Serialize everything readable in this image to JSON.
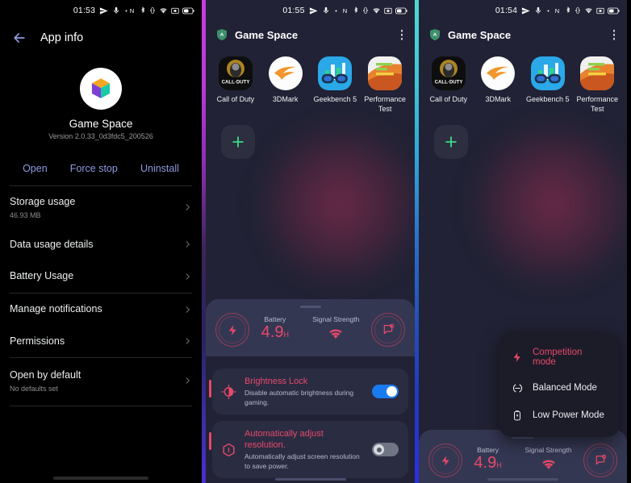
{
  "panel1": {
    "statusbar": {
      "time": "01:53",
      "icons_left": [
        "send-icon",
        "silent-icon",
        "dot-icon"
      ],
      "icons_right": [
        "nfc-icon",
        "bluetooth-icon",
        "vibrate-icon",
        "wifi-icon",
        "sim-icon",
        "battery-icon"
      ]
    },
    "appbar": {
      "back": "back-arrow",
      "title": "App info"
    },
    "hero": {
      "icon": "game-space-cube-icon",
      "app_name": "Game Space",
      "version": "Version 2.0.33_0d3fdc5_200526"
    },
    "actions": [
      {
        "label": "Open",
        "name": "open-button"
      },
      {
        "label": "Force stop",
        "name": "force-stop-button"
      },
      {
        "label": "Uninstall",
        "name": "uninstall-button"
      }
    ],
    "rows_group_1": [
      {
        "title": "Storage usage",
        "sub": "46.93 MB",
        "name": "row-storage-usage"
      },
      {
        "title": "Data usage details",
        "sub": "",
        "name": "row-data-usage-details"
      },
      {
        "title": "Battery Usage",
        "sub": "",
        "name": "row-battery-usage"
      }
    ],
    "rows_group_2": [
      {
        "title": "Manage notifications",
        "sub": "",
        "name": "row-manage-notifications"
      },
      {
        "title": "Permissions",
        "sub": "",
        "name": "row-permissions"
      }
    ],
    "rows_group_3": [
      {
        "title": "Open by default",
        "sub": "No defaults set",
        "name": "row-open-by-default"
      }
    ]
  },
  "panel2": {
    "statusbar": {
      "time": "01:55"
    },
    "appbar": {
      "title": "Game Space",
      "logo": "game-space-shield-icon",
      "menu": "overflow-menu-icon"
    },
    "games": [
      {
        "label": "Call of Duty",
        "icon": "call-of-duty-icon"
      },
      {
        "label": "3DMark",
        "icon": "3dmark-icon"
      },
      {
        "label": "Geekbench 5",
        "icon": "geekbench-icon"
      },
      {
        "label": "Performance Test",
        "icon": "performancetest-icon"
      }
    ],
    "add_button": "add-game-button",
    "stats": {
      "left_icon": "performance-mode-icon",
      "right_icon": "notification-block-icon",
      "battery_caption": "Battery",
      "battery_value": "4.9",
      "battery_unit": "H",
      "signal_caption": "Signal Strength",
      "signal_icon": "wifi-signal-icon"
    },
    "toggles": [
      {
        "title": "Brightness Lock",
        "desc": "Disable automatic brightness during gaming.",
        "state": "on",
        "icon": "brightness-icon",
        "name": "toggle-brightness-lock"
      },
      {
        "title": "Automatically adjust resolution.",
        "desc": "Automatically adjust screen resolution to save power.",
        "state": "off",
        "icon": "resolution-icon",
        "name": "toggle-auto-resolution"
      }
    ]
  },
  "panel3": {
    "statusbar": {
      "time": "01:54"
    },
    "appbar": {
      "title": "Game Space",
      "logo": "game-space-shield-icon",
      "menu": "overflow-menu-icon"
    },
    "games": [
      {
        "label": "Call of Duty",
        "icon": "call-of-duty-icon"
      },
      {
        "label": "3DMark",
        "icon": "3dmark-icon"
      },
      {
        "label": "Geekbench 5",
        "icon": "geekbench-icon"
      },
      {
        "label": "Performance Test",
        "icon": "performancetest-icon"
      }
    ],
    "add_button": "add-game-button",
    "menu": {
      "items": [
        {
          "label": "Competition mode",
          "icon": "bolt-icon",
          "selected": true
        },
        {
          "label": "Balanced Mode",
          "icon": "balance-icon",
          "selected": false
        },
        {
          "label": "Low Power Mode",
          "icon": "battery-saver-icon",
          "selected": false
        }
      ]
    },
    "stats": {
      "left_icon": "performance-mode-icon",
      "right_icon": "notification-block-icon",
      "battery_caption": "Battery",
      "battery_value": "4.9",
      "battery_unit": "H",
      "signal_caption": "Signal Strength",
      "signal_icon": "wifi-signal-icon"
    }
  },
  "colors": {
    "accent_pink": "#e8496a",
    "accent_blue_link": "#8f9adf",
    "toggle_on": "#1a7bf0",
    "panel_bg": "#212235",
    "card_bg": "#2a2c42",
    "stats_bg": "#343752",
    "add_green": "#3ddc84"
  }
}
